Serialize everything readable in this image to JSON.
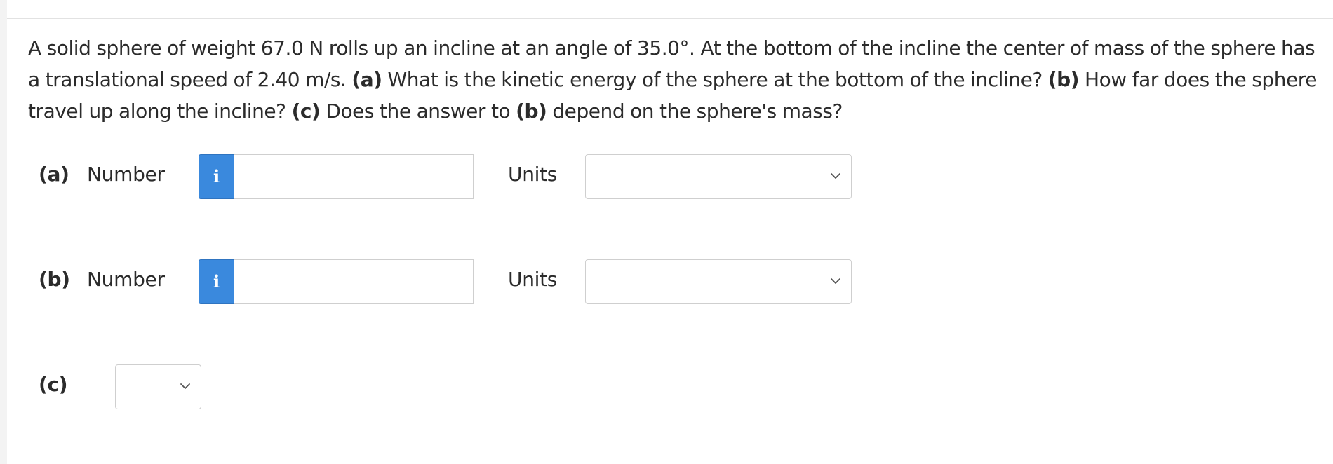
{
  "question": {
    "seg1": "A solid sphere of weight 67.0 N rolls up an incline at an angle of 35.0°. At the bottom of the incline the center of mass of the sphere has a translational speed of 2.40 m/s. ",
    "tag_a": "(a)",
    "seg2": " What is the kinetic energy of the sphere at the bottom of the incline? ",
    "tag_b": "(b)",
    "seg3": " How far does the sphere travel up along the incline? ",
    "tag_c": "(c)",
    "seg4": " Does the answer to ",
    "tag_b2": "(b)",
    "seg5": " depend on the sphere's mass?"
  },
  "parts": {
    "a": {
      "label": "(a)",
      "number_label": "Number",
      "info_icon": "i",
      "number_value": "",
      "units_label": "Units",
      "units_value": ""
    },
    "b": {
      "label": "(b)",
      "number_label": "Number",
      "info_icon": "i",
      "number_value": "",
      "units_label": "Units",
      "units_value": ""
    },
    "c": {
      "label": "(c)",
      "select_value": ""
    }
  },
  "icons": {
    "info": "info-icon",
    "dropdown": "chevron-down-icon"
  },
  "colors": {
    "info_button": "#3a89dd",
    "border": "#cfcfcf",
    "text": "#2b2b2b"
  }
}
